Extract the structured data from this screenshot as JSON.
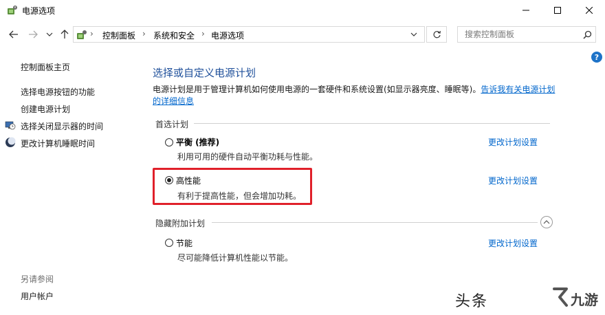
{
  "window": {
    "title": "电源选项"
  },
  "address_bar": {
    "crumbs": [
      "控制面板",
      "系统和安全",
      "电源选项"
    ],
    "search_placeholder": "搜索控制面板"
  },
  "sidebar": {
    "home": "控制面板主页",
    "items": [
      {
        "label": "选择电源按钮的功能",
        "icon": "none"
      },
      {
        "label": "创建电源计划",
        "icon": "none"
      },
      {
        "label": "选择关闭显示器的时间",
        "icon": "monitor-clock-icon"
      },
      {
        "label": "更改计算机睡眠时间",
        "icon": "moon-icon"
      }
    ],
    "see_also_title": "另请参阅",
    "see_also_items": [
      "用户帐户"
    ]
  },
  "main": {
    "heading": "选择或自定义电源计划",
    "description": "电源计划是用于管理计算机如何使用电源的一套硬件和系统设置(如显示器亮度、睡眠等)。",
    "description_link": "告诉我有关电源计划的详细信息",
    "preferred_section": "首选计划",
    "hidden_section": "隐藏附加计划",
    "plans": [
      {
        "name": "平衡 (推荐)",
        "description": "利用可用的硬件自动平衡功耗与性能。",
        "link": "更改计划设置",
        "selected": false
      },
      {
        "name": "高性能",
        "description": "有利于提高性能，但会增加功耗。",
        "link": "更改计划设置",
        "selected": true
      },
      {
        "name": "节能",
        "description": "尽可能降低计算机性能以节能。",
        "link": "更改计划设置",
        "selected": false
      }
    ]
  },
  "watermark": {
    "text": "头条",
    "logo_text": "九游"
  },
  "colors": {
    "heading_blue": "#1e4f9a",
    "link_blue": "#0066cc",
    "highlight_red": "#e0202a"
  }
}
